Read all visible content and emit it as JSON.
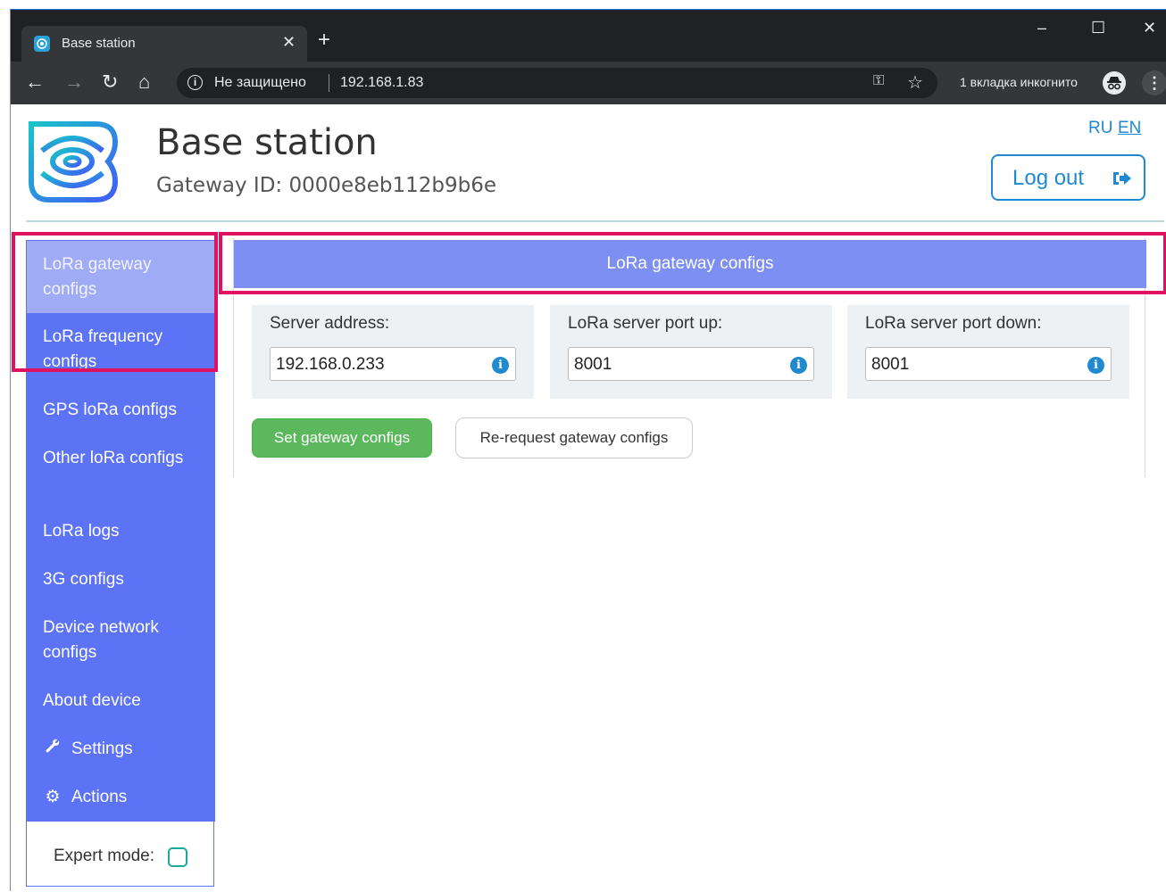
{
  "browser": {
    "tab_title": "Base station",
    "tab_close": "✕",
    "new_tab": "+",
    "security_label": "Не защищено",
    "url": "192.168.1.83",
    "incognito_label": "1 вкладка инкогнито",
    "window_controls": [
      "–",
      "☐",
      "✕"
    ]
  },
  "header": {
    "title": "Base station",
    "gateway_id": "Gateway ID: 0000e8eb112b9b6e",
    "lang_ru": "RU",
    "lang_en": "EN",
    "logout_label": "Log out"
  },
  "sidebar": {
    "items": [
      {
        "label": "LoRa gateway configs",
        "active": true
      },
      {
        "label": "LoRa frequency configs"
      },
      {
        "label": "GPS loRa configs"
      },
      {
        "label": "Other loRa configs"
      },
      {
        "label": "LoRa logs"
      },
      {
        "label": "3G configs"
      },
      {
        "label": "Device network configs"
      },
      {
        "label": "About device"
      },
      {
        "label": "Settings",
        "icon": "wrench-icon"
      },
      {
        "label": "Actions",
        "icon": "gear-icon"
      }
    ],
    "expert_mode_label": "Expert mode:"
  },
  "panel": {
    "title": "LoRa gateway configs",
    "fields": [
      {
        "label": "Server address:",
        "value": "192.168.0.233"
      },
      {
        "label": "LoRa server port up:",
        "value": "8001"
      },
      {
        "label": "LoRa server port down:",
        "value": "8001"
      }
    ],
    "set_button": "Set gateway configs",
    "rerequest_button": "Re-request gateway configs"
  },
  "colors": {
    "sidebar": "#5b73f4",
    "sidebar_active": "#9fabf5",
    "panel_header": "#7d8ff3",
    "primary_green": "#5cb85c",
    "link_blue": "#1f8ad0",
    "highlight": "#e0115f"
  }
}
